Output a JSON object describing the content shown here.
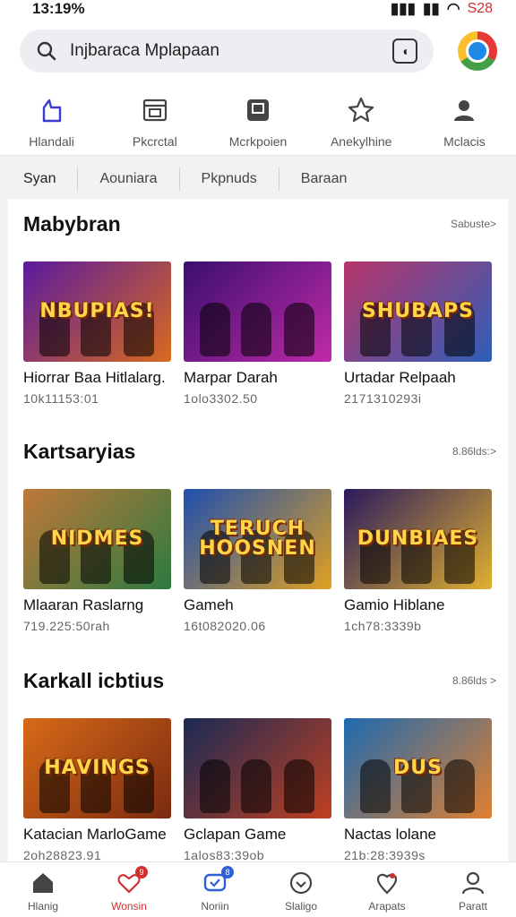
{
  "status": {
    "time": "13:19%",
    "battery": "S28"
  },
  "search": {
    "value": "Injbaraca Mplapaan"
  },
  "category_tabs": [
    {
      "label": "Hlandali",
      "icon": "bag-icon",
      "active": true
    },
    {
      "label": "Pkcrctal",
      "icon": "store-icon",
      "active": false
    },
    {
      "label": "Mcrkpoien",
      "icon": "bookmark-icon",
      "active": false
    },
    {
      "label": "Anekylhine",
      "icon": "star-icon",
      "active": false
    },
    {
      "label": "Mclacis",
      "icon": "person-icon",
      "active": false
    }
  ],
  "filters": [
    "Syan",
    "Aouniara",
    "Pkpnuds",
    "Baraan"
  ],
  "sections": [
    {
      "title": "Mabybran",
      "more": "Sabuste>",
      "cards": [
        {
          "title": "Hiorrar Baa Hitlalarg.",
          "sub": "10k11153:01",
          "art": "NBUPIAS!",
          "colors": [
            "#5a1a9e",
            "#d96a1e"
          ]
        },
        {
          "title": "Marpar Darah",
          "sub": "1olo3302.50",
          "art": "",
          "colors": [
            "#3a0f6e",
            "#c02aa8"
          ]
        },
        {
          "title": "Urtadar Relpaah",
          "sub": "2171310293i",
          "art": "SHUBAPS",
          "colors": [
            "#b8356a",
            "#2e5fb8"
          ]
        }
      ]
    },
    {
      "title": "Kartsaryias",
      "more": "8.86lds:>",
      "cards": [
        {
          "title": "Mlaaran Raslarng",
          "sub": "719.225:50rah",
          "art": "NIDMES",
          "colors": [
            "#c0783a",
            "#2c7a3f"
          ]
        },
        {
          "title": "Gameh",
          "sub": "16t082020.06",
          "art": "TERUCH HOOSNEN",
          "colors": [
            "#1d4fb0",
            "#e0a020"
          ]
        },
        {
          "title": "Gamio Hiblane",
          "sub": "1ch78:3339b",
          "art": "DUNBIAES",
          "colors": [
            "#2a1a5e",
            "#e0b030"
          ]
        }
      ]
    },
    {
      "title": "Karkall icbtius",
      "more": "8.86lds >",
      "cards": [
        {
          "title": "Katacian MarloGame",
          "sub": "2oh28823.91",
          "art": "HAVINGS",
          "colors": [
            "#d86a18",
            "#7a2a10"
          ]
        },
        {
          "title": "Gclapan Game",
          "sub": "1alos83:39ob",
          "art": "",
          "colors": [
            "#1a2a55",
            "#c04020"
          ]
        },
        {
          "title": "Nactas lolane",
          "sub": "21b:28:3939s",
          "art": "DUS",
          "colors": [
            "#1d6ab0",
            "#e08030"
          ]
        }
      ]
    }
  ],
  "bottom_nav": [
    {
      "label": "Hlanig",
      "icon": "home-icon",
      "active": false,
      "badge": ""
    },
    {
      "label": "Wonsin",
      "icon": "heart-icon",
      "active": true,
      "badge": "9"
    },
    {
      "label": "Noriin",
      "icon": "chat-icon",
      "active": false,
      "badge": "8"
    },
    {
      "label": "Slaligo",
      "icon": "smile-icon",
      "active": false,
      "badge": ""
    },
    {
      "label": "Arapats",
      "icon": "location-icon",
      "active": false,
      "badge": ""
    },
    {
      "label": "Paratt",
      "icon": "profile-icon",
      "active": false,
      "badge": ""
    }
  ],
  "colors": {
    "accent": "#3f3fd8",
    "active_red": "#d32f2f"
  }
}
